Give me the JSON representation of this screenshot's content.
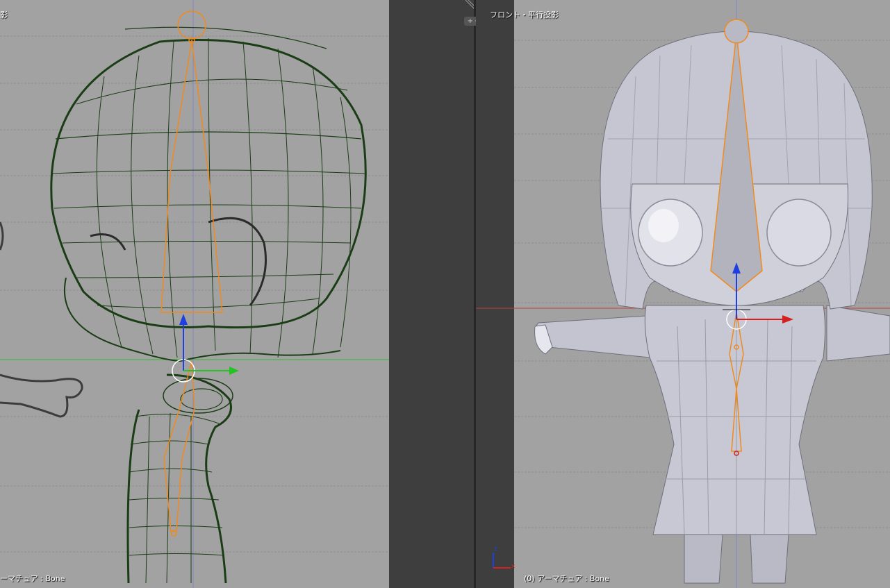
{
  "left_view": {
    "title": "影",
    "status": "ーマチュア : Bone"
  },
  "right_view": {
    "title": "フロント・平行投影",
    "status": "(0) アーマチュア : Bone"
  },
  "colors": {
    "viewport_bg": "#a2a2a2",
    "panel_dark": "#3e3e3e",
    "wireframe": "#1b3d16",
    "bone": "#f08a1e",
    "axis_x": "#d62020",
    "axis_y": "#22c422",
    "axis_z": "#1f3fe0",
    "mesh": "#c8c9d4"
  },
  "icons": {
    "split": "area-split-icon",
    "corner": "corner-grip-icon",
    "axis": "axis-gizmo-icon"
  }
}
